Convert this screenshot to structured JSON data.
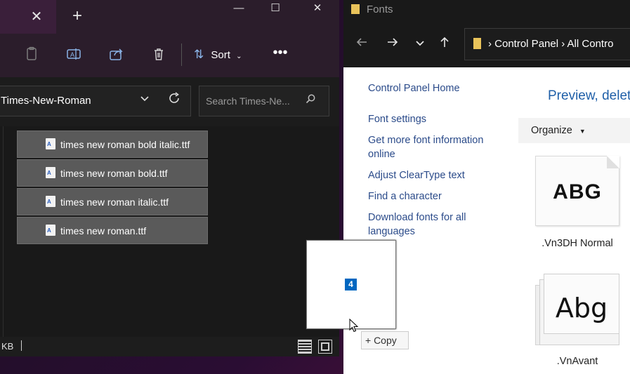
{
  "explorer": {
    "tab_close": "✕",
    "new_tab": "+",
    "window_controls": {
      "minimize": "—",
      "maximize": "☐",
      "close": "✕"
    },
    "toolbar": {
      "icons": [
        "paste-icon",
        "rename-icon",
        "share-icon",
        "delete-icon"
      ],
      "sort_label": "Sort",
      "more": "•••"
    },
    "address": {
      "path": "Times-New-Roman"
    },
    "search": {
      "placeholder": "Search Times-Ne..."
    },
    "files": [
      "times new roman bold italic.ttf",
      "times new roman bold.ttf",
      "times new roman italic.ttf",
      "times new roman.ttf"
    ],
    "status": {
      "text": "KB"
    }
  },
  "control_panel": {
    "title": "Fonts",
    "breadcrumb": "›  Control Panel  ›  All Contro",
    "links": [
      "Control Panel Home",
      "Font settings",
      "Get more font information",
      "online",
      "Adjust ClearType text",
      "Find a character",
      "Download fonts for all",
      "languages"
    ],
    "heading": "Preview, delet",
    "organize_label": "Organize",
    "fonts": [
      {
        "sample": "ABG",
        "name": ".Vn3DH Normal"
      },
      {
        "sample": "Abg",
        "name": ".VnAvant"
      }
    ]
  },
  "drag": {
    "count": "4",
    "copy_label": "+ Copy"
  },
  "colors": {
    "accent": "#0067c0",
    "link": "#2b4b8a",
    "heading": "#1f5fa8"
  }
}
